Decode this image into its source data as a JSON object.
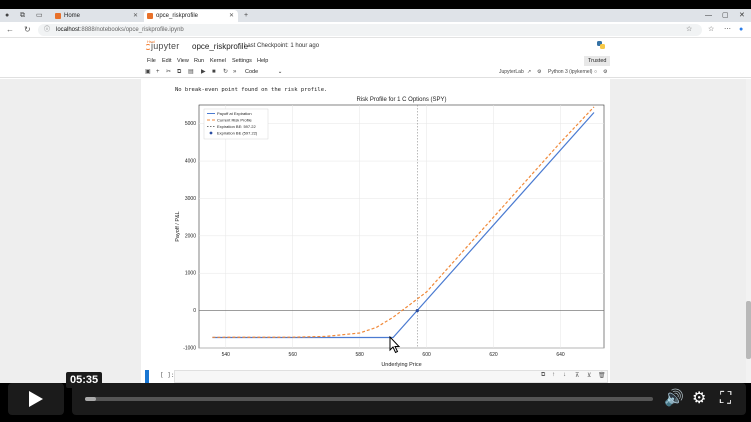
{
  "browser": {
    "tabs": [
      {
        "label": "Home",
        "active": false
      },
      {
        "label": "opce_riskprofile",
        "active": true
      }
    ],
    "url_host": "localhost",
    "url_path": ":8888/notebooks/opce_riskprofile.ipynb"
  },
  "jupyter": {
    "logo_small": "Hsol",
    "logo_word": "jupyter",
    "notebook_name": "opce_riskprofile",
    "checkpoint": "Last Checkpoint: 1 hour ago",
    "menu": [
      "File",
      "Edit",
      "View",
      "Run",
      "Kernel",
      "Settings",
      "Help"
    ],
    "trusted": "Trusted",
    "cell_type": "Code",
    "toolbar_right": {
      "jupyterlab": "JupyterLab",
      "kernel": "Python 3 (ipykernel)"
    }
  },
  "notebook": {
    "output_text": "No break-even point found on the risk profile.",
    "next_cell_prompt": "[ ]:"
  },
  "chart_data": {
    "type": "line",
    "title": "Risk Profile for 1 C Options (SPY)",
    "xlabel": "Underlying Price",
    "ylabel": "Payoff / P&L",
    "xlim": [
      532,
      653
    ],
    "ylim": [
      -1000,
      5500
    ],
    "xticks": [
      540,
      560,
      580,
      600,
      620,
      640
    ],
    "yticks": [
      -1000,
      0,
      1000,
      2000,
      3000,
      4000,
      5000
    ],
    "grid": true,
    "legend_position": "top-left",
    "legend": [
      "Payoff at Expiration",
      "Current Risk Profile",
      "Expiration BE: 597.22",
      "Expiration BE (597.22)"
    ],
    "breakeven": 597.22,
    "series": [
      {
        "name": "Payoff at Expiration",
        "color": "#4b7bd1",
        "style": "solid",
        "x": [
          536,
          590,
          650
        ],
        "y": [
          -720,
          -720,
          5300
        ]
      },
      {
        "name": "Current Risk Profile",
        "color": "#f08a3b",
        "style": "dashed",
        "x": [
          536,
          560,
          570,
          580,
          585,
          590,
          595,
          600,
          610,
          620,
          630,
          640,
          650
        ],
        "y": [
          -715,
          -710,
          -690,
          -600,
          -450,
          -180,
          160,
          500,
          1500,
          2500,
          3500,
          4500,
          5450
        ]
      }
    ],
    "breakeven_point": {
      "x": 597.22,
      "y": 0
    }
  },
  "player": {
    "time": "05:35",
    "progress": 0.02
  }
}
